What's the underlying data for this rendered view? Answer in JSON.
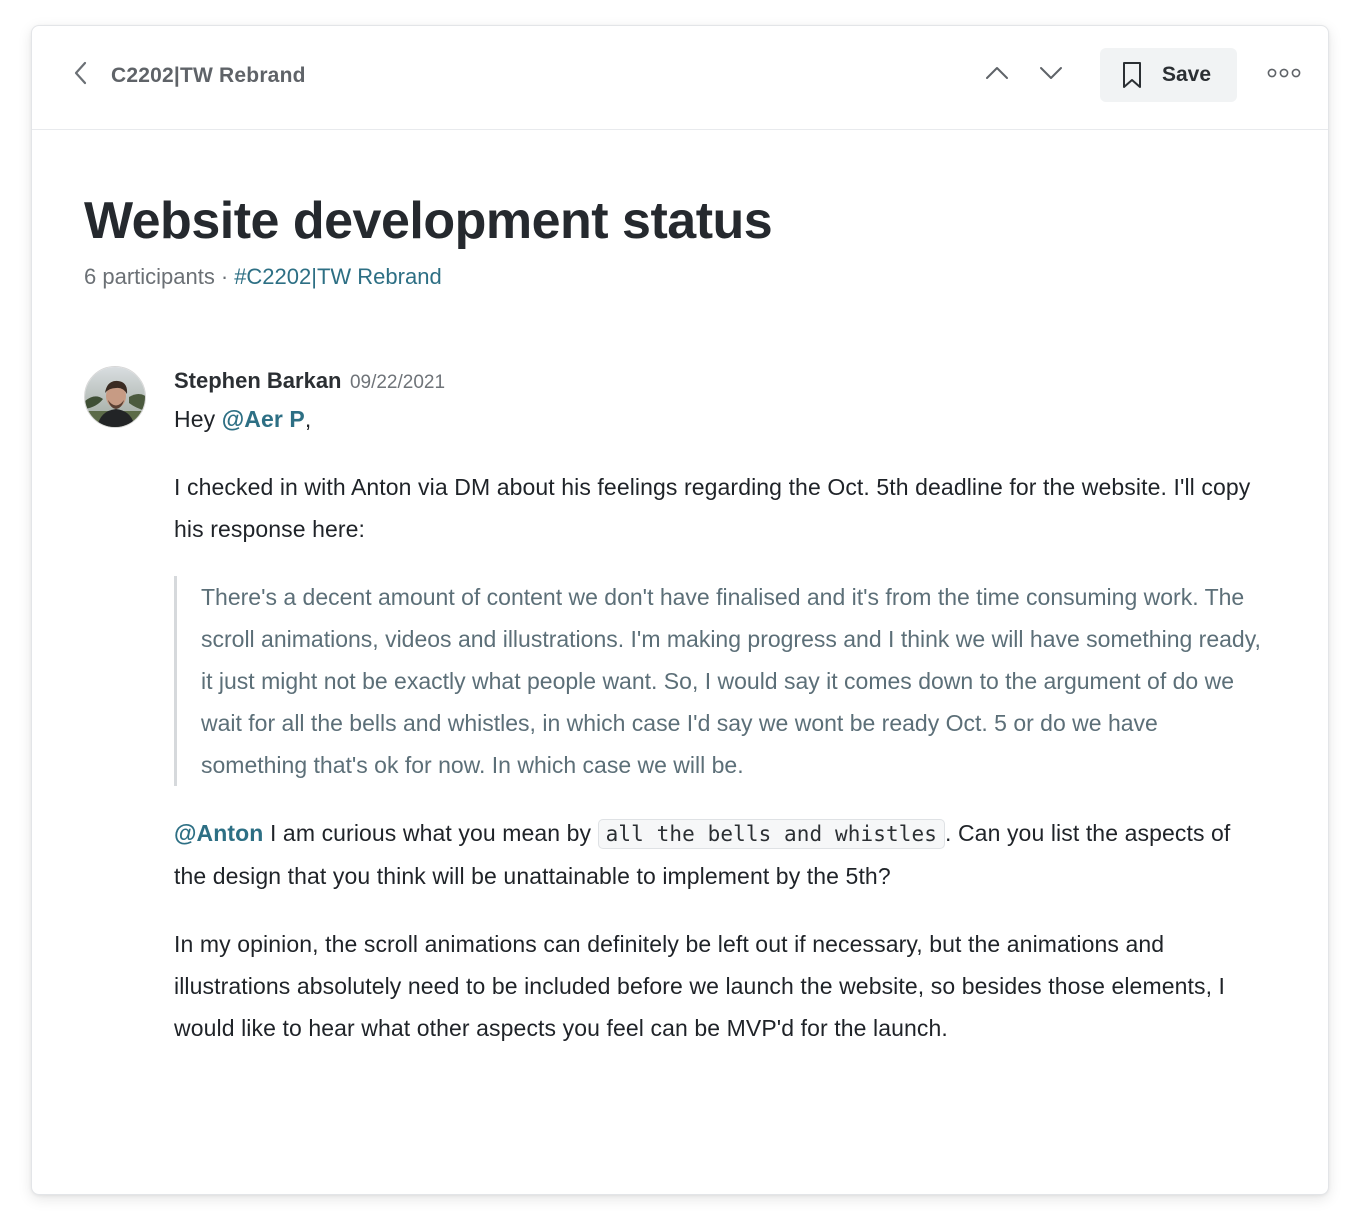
{
  "header": {
    "channel_name": "C2202|TW Rebrand",
    "save_label": "Save"
  },
  "thread": {
    "title": "Website development status",
    "participants": "6 participants",
    "separator": "·",
    "channel_link": "#C2202|TW Rebrand"
  },
  "message": {
    "author": "Stephen Barkan",
    "date": "09/22/2021",
    "greeting_prefix": "Hey ",
    "greeting_mention": "@Aer P",
    "greeting_suffix": ",",
    "para1": "I checked in with Anton via DM about his feelings regarding the Oct. 5th deadline for the website. I'll copy his response here:",
    "quote": "There's a decent amount of content we don't have finalised and it's from the time consuming work. The scroll animations, videos and illustrations. I'm making progress and I think we will have something ready, it just might not be exactly what people want. So, I would say it comes down to the argument of do we wait for all the bells and whistles, in which case I'd say we wont be ready Oct. 5 or do we have something that's ok for now. In which case we will be.",
    "para3_mention": "@Anton",
    "para3_before_code": " I am curious what you mean by ",
    "para3_code": "all the bells and whistles",
    "para3_after_code": ". Can you list the aspects of the design that you think will be unattainable to implement by the 5th?",
    "para4": "In my opinion, the scroll animations can definitely be left out if necessary, but the animations and illustrations absolutely need to be included before we launch the website, so besides those elements, I would like to hear what other aspects you feel can be MVP'd for the launch."
  },
  "icons": {
    "back": "chevron-left-icon",
    "prev": "chevron-up-icon",
    "next": "chevron-down-icon",
    "save": "bookmark-icon",
    "more": "more-horizontal-icon"
  },
  "colors": {
    "accent_link": "#2d6f84",
    "quote_text": "#5c6f78",
    "save_bg": "#f1f3f4"
  }
}
